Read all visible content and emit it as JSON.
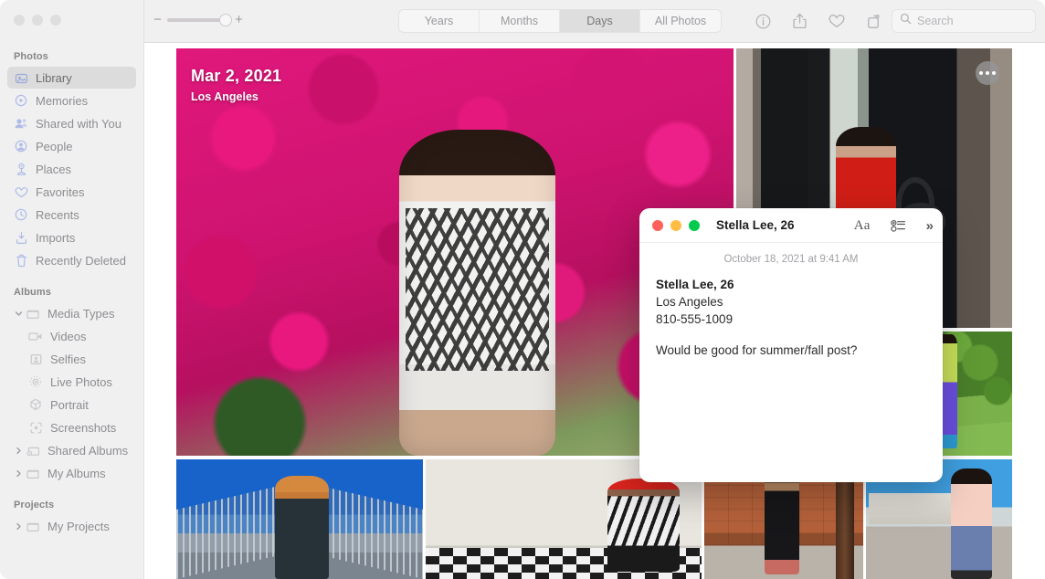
{
  "window": {
    "traffic_lights": [
      "close",
      "minimize",
      "zoom"
    ]
  },
  "toolbar": {
    "zoom_minus": "−",
    "zoom_plus": "+",
    "zoom_value": 78,
    "segments": [
      {
        "label": "Years",
        "active": false
      },
      {
        "label": "Months",
        "active": false
      },
      {
        "label": "Days",
        "active": true
      },
      {
        "label": "All Photos",
        "active": false
      }
    ],
    "icons": [
      "info-icon",
      "share-icon",
      "favorite-heart-icon",
      "rotate-icon"
    ],
    "search": {
      "placeholder": "Search",
      "value": ""
    }
  },
  "sidebar": {
    "sections": [
      {
        "header": "Photos",
        "items": [
          {
            "label": "Library",
            "icon": "library-icon",
            "selected": true,
            "indent": 0,
            "disclosure": ""
          },
          {
            "label": "Memories",
            "icon": "memories-icon",
            "selected": false,
            "indent": 0,
            "disclosure": ""
          },
          {
            "label": "Shared with You",
            "icon": "shared-with-you-icon",
            "selected": false,
            "indent": 0,
            "disclosure": ""
          },
          {
            "label": "People",
            "icon": "people-icon",
            "selected": false,
            "indent": 0,
            "disclosure": ""
          },
          {
            "label": "Places",
            "icon": "places-icon",
            "selected": false,
            "indent": 0,
            "disclosure": ""
          },
          {
            "label": "Favorites",
            "icon": "heart-icon",
            "selected": false,
            "indent": 0,
            "disclosure": ""
          },
          {
            "label": "Recents",
            "icon": "clock-icon",
            "selected": false,
            "indent": 0,
            "disclosure": ""
          },
          {
            "label": "Imports",
            "icon": "import-icon",
            "selected": false,
            "indent": 0,
            "disclosure": ""
          },
          {
            "label": "Recently Deleted",
            "icon": "trash-icon",
            "selected": false,
            "indent": 0,
            "disclosure": ""
          }
        ]
      },
      {
        "header": "Albums",
        "items": [
          {
            "label": "Media Types",
            "icon": "folder-icon",
            "selected": false,
            "indent": 0,
            "disclosure": "down"
          },
          {
            "label": "Videos",
            "icon": "video-icon",
            "selected": false,
            "indent": 1,
            "disclosure": ""
          },
          {
            "label": "Selfies",
            "icon": "selfie-icon",
            "selected": false,
            "indent": 1,
            "disclosure": ""
          },
          {
            "label": "Live Photos",
            "icon": "live-photo-icon",
            "selected": false,
            "indent": 1,
            "disclosure": ""
          },
          {
            "label": "Portrait",
            "icon": "portrait-icon",
            "selected": false,
            "indent": 1,
            "disclosure": ""
          },
          {
            "label": "Screenshots",
            "icon": "screenshot-icon",
            "selected": false,
            "indent": 1,
            "disclosure": ""
          },
          {
            "label": "Shared Albums",
            "icon": "shared-album-icon",
            "selected": false,
            "indent": 0,
            "disclosure": "right"
          },
          {
            "label": "My Albums",
            "icon": "folder-icon",
            "selected": false,
            "indent": 0,
            "disclosure": "right"
          }
        ]
      },
      {
        "header": "Projects",
        "items": [
          {
            "label": "My Projects",
            "icon": "folder-icon",
            "selected": false,
            "indent": 0,
            "disclosure": "right"
          }
        ]
      }
    ]
  },
  "grid": {
    "day_overlay": {
      "date": "Mar 2, 2021",
      "place": "Los Angeles"
    },
    "more_button": "more-options-icon",
    "photos": [
      {
        "name": "photo-flowers-portrait",
        "alt": "Woman in patterned dress beside pink bougainvillea"
      },
      {
        "name": "photo-red-jacket",
        "alt": "Person in red jacket by dark doorway"
      },
      {
        "name": "photo-green-yard",
        "alt": "Person in yellow top and purple pants in a garden"
      },
      {
        "name": "photo-bridge-walkway",
        "alt": "Person in dark coat on a bridge walkway"
      },
      {
        "name": "photo-checkerboard-floor",
        "alt": "Person in red hat seated on checkerboard floor"
      },
      {
        "name": "photo-brick-wall",
        "alt": "Person in black dress by a brick wall"
      },
      {
        "name": "photo-street-scene",
        "alt": "Person in pink jacket on a sunny street"
      }
    ]
  },
  "notes": {
    "title": "Stella Lee, 26",
    "actions": {
      "format": "Aa",
      "checklist": "checklist-icon",
      "expand": "»"
    },
    "date": "October 18, 2021 at 9:41 AM",
    "heading": "Stella Lee, 26",
    "lines": [
      "Los Angeles",
      "810-555-1009"
    ],
    "memo": "Would be good for summer/fall post?"
  },
  "colors": {
    "sidebar_bg": "#f0f0f0",
    "toolbar_bg": "#f0f0f0",
    "selected_row": "#dcdcdc",
    "sidebar_icon": "#aebbe8",
    "traffic_red": "#ff605c",
    "traffic_yellow": "#ffbd44",
    "traffic_green": "#00ca4e"
  }
}
